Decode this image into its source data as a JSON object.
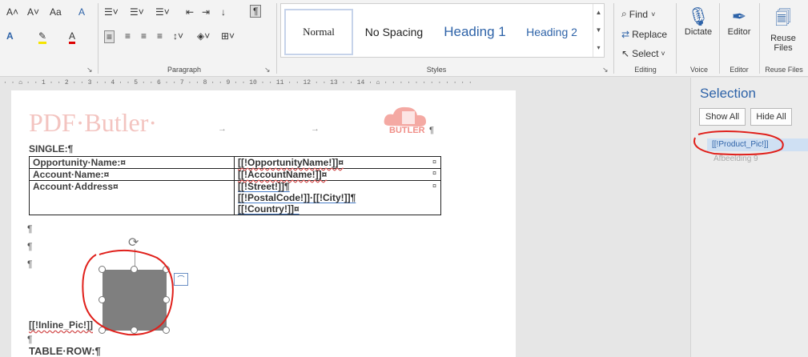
{
  "ribbon": {
    "font": {
      "grow": "A˄",
      "shrink": "A˅",
      "case": "Aa",
      "clear": "A",
      "effects": "A",
      "highlight": "✎",
      "color": "A"
    },
    "paragraph_label": "Paragraph",
    "styles_label": "Styles",
    "styles": [
      "Normal",
      "No Spacing",
      "Heading 1",
      "Heading 2"
    ],
    "editing": {
      "find": "Find",
      "replace": "Replace",
      "select": "Select",
      "label": "Editing"
    },
    "dictate": {
      "label": "Dictate",
      "group": "Voice"
    },
    "editor": {
      "label": "Editor",
      "group": "Editor"
    },
    "reuse": {
      "label1": "Reuse",
      "label2": "Files",
      "group": "Reuse Files"
    }
  },
  "ruler": "· · ⌂ · · 1 · · 2 · · 3 · · 4 · · 5 · · 6 · · 7 · · 8 · · 9 · · 10 · · 11 · · 12 · · 13 · · 14 · ⌂ · · · · · · · · · · · ·",
  "document": {
    "logo_title": "PDF·Butler·",
    "arrows": [
      "→",
      "→"
    ],
    "logo_text": "BUTLER",
    "pilcrow": "¶",
    "single_heading": "SINGLE:¶",
    "rows": [
      {
        "label": "Opportunity·Name:¤",
        "value": "[[!OpportunityName!]]¤"
      },
      {
        "label": "Account·Name:¤",
        "value": "[[!AccountName!]]¤"
      },
      {
        "label": "Account·Address¤",
        "value_lines": [
          "[[!Street!]]¶",
          "[[!PostalCode!]]·[[!City!]]¶",
          "[[!Country!]]¤"
        ]
      }
    ],
    "cell_end": "¤",
    "inline_pic": "[[!Inline_Pic!]]",
    "table_row": "TABLE·ROW:¶"
  },
  "selection_pane": {
    "title": "Selection",
    "show_all": "Show All",
    "hide_all": "Hide All",
    "items": [
      "[[!Product_Pic!]]",
      "Afbeelding 9"
    ]
  },
  "colors": {
    "accent": "#2e63a8",
    "annotation": "#e0201b"
  }
}
